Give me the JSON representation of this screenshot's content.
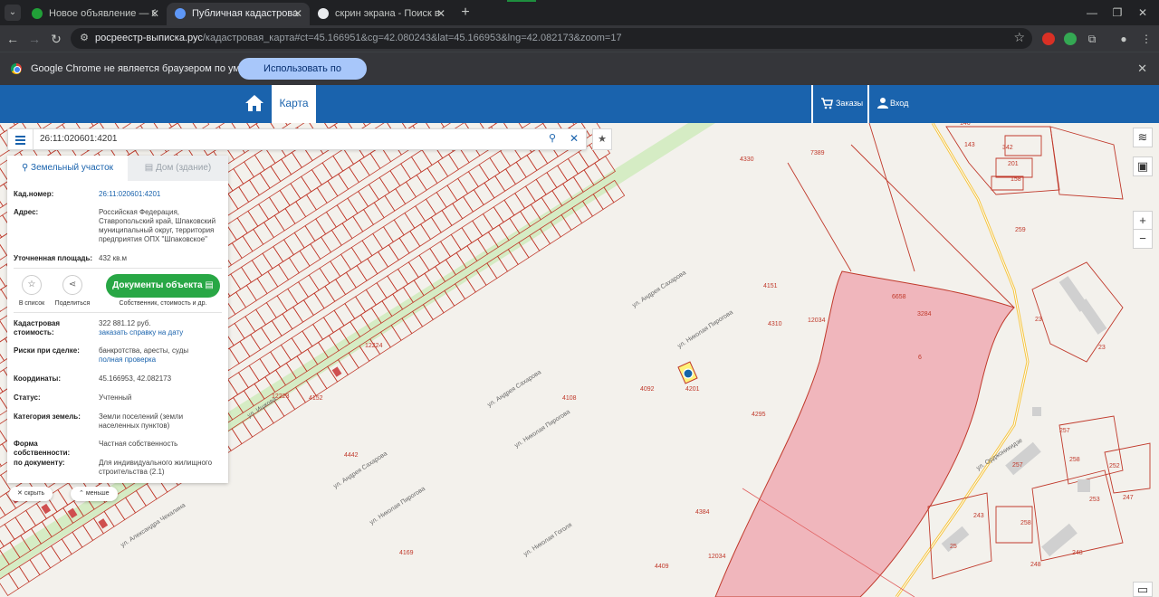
{
  "browser": {
    "tabs": [
      {
        "title": "Новое объявление — Объявления",
        "favicon_color": "#21a038"
      },
      {
        "title": "Публичная кадастровая карта",
        "favicon_color": "#5e97f6"
      },
      {
        "title": "скрин экрана - Поиск в Google",
        "favicon_color": "#e8eaed"
      }
    ],
    "tab_close_glyph": "✕",
    "new_tab_glyph": "+",
    "address": {
      "domain": "росреестр-выписка.рус",
      "path": "/кадастровая_карта#ct=45.166951&cg=42.080243&lat=45.166953&lng=42.082173&zoom=17"
    },
    "infobar": {
      "message": "Google Chrome не является браузером по умолчанию.",
      "button": "Использовать по умолчанию"
    }
  },
  "site": {
    "nav": {
      "map": "Карта",
      "orders": "Заказы",
      "login": "Вход"
    },
    "accent": "#1a63ad"
  },
  "search": {
    "query": "26:11:020601:4201"
  },
  "panel": {
    "tabs": {
      "land": "Земельный участок",
      "building": "Дом (здание)"
    },
    "cad_number": {
      "label": "Кад.номер:",
      "value": "26:11:020601:4201"
    },
    "address": {
      "label": "Адрес:",
      "value": "Российская Федерация, Ставропольский край, Шпаковский муниципальный округ, территория предприятия ОПХ \"Шпаковское\""
    },
    "area": {
      "label": "Уточненная площадь:",
      "value": "432 кв.м"
    },
    "actions": {
      "to_list": "В список",
      "share": "Поделиться",
      "documents": "Документы объекта",
      "documents_sub": "Собственник, стоимость и др."
    },
    "cost": {
      "label": "Кадастровая стоимость:",
      "value": "322 881.12 руб.",
      "link": "заказать справку на дату"
    },
    "risks": {
      "label": "Риски при сделке:",
      "value": "банкротства, аресты, суды",
      "link": "полная проверка"
    },
    "coords": {
      "label": "Координаты:",
      "value": "45.166953, 42.082173"
    },
    "status": {
      "label": "Статус:",
      "value": "Учтенный"
    },
    "category": {
      "label": "Категория земель:",
      "value": "Земли поселений (земли населенных пунктов)"
    },
    "ownership": {
      "label": "Форма собственности:",
      "value": "Частная собственность"
    },
    "document": {
      "label": "по документу:",
      "value": "Для индивидуального жилищного строительства (2.1)"
    },
    "hide": "скрыть",
    "less": "меньше"
  },
  "map": {
    "streets": [
      "ул. Андрея Сахарова",
      "ул. Николая Пирогова",
      "ул. Андрея Сахарова",
      "ул. Николая Пирогова",
      "ул. Ишкова",
      "ул. Александра Чекалина",
      "ул. Андрея Сахарова",
      "ул. Николая Пирогова",
      "ул. Николая Гоголя",
      "ул. Орджоникидзе"
    ],
    "labels": [
      "7389",
      "6658",
      "3284",
      "6",
      "12034",
      "12034",
      "259",
      "143",
      "342",
      "201",
      "158",
      "146",
      "23",
      "23",
      "257",
      "257",
      "258",
      "258",
      "252",
      "253",
      "247",
      "243",
      "25",
      "248",
      "248",
      "12224",
      "12223",
      "4330",
      "4201",
      "4152",
      "4442",
      "4151",
      "4310",
      "4295",
      "4384",
      "4409",
      "4169",
      "4108",
      "4092"
    ],
    "colors": {
      "parcel": "#c0392b",
      "zone": "#f0b6bc",
      "marker": "#1565a8",
      "selected": "#fff27a"
    }
  }
}
